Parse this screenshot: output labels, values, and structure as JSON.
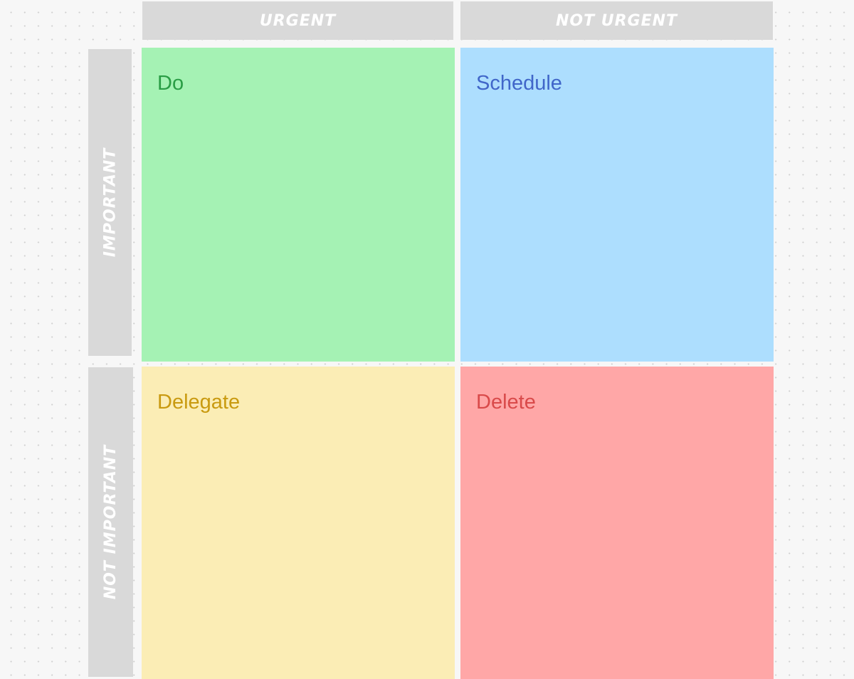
{
  "matrix": {
    "columns": [
      {
        "label": "URGENT"
      },
      {
        "label": "NOT URGENT"
      }
    ],
    "rows": [
      {
        "label": "IMPORTANT"
      },
      {
        "label": "NOT IMPORTANT"
      }
    ],
    "quadrants": {
      "do": {
        "label": "Do",
        "background": "#a5f2b4",
        "text_color": "#2a9d45"
      },
      "schedule": {
        "label": "Schedule",
        "background": "#addefe",
        "text_color": "#4066c9"
      },
      "delegate": {
        "label": "Delegate",
        "background": "#fbedb5",
        "text_color": "#c99a10"
      },
      "delete": {
        "label": "Delete",
        "background": "#ffa7a7",
        "text_color": "#d94a4a"
      }
    },
    "header_color": "#d9d9d9"
  }
}
